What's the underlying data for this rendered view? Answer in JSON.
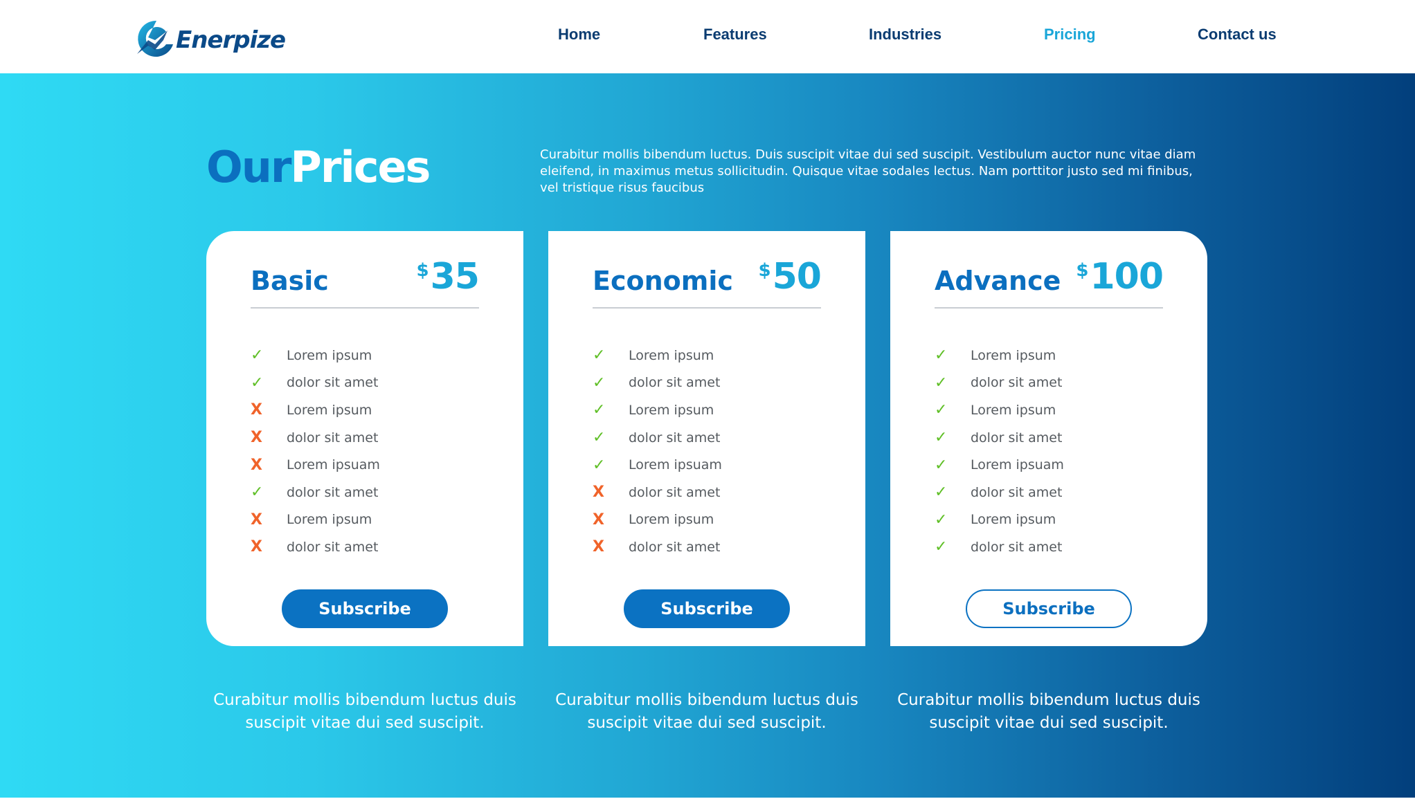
{
  "brand": {
    "name": "Enerpize",
    "colors": {
      "primary": "#0b6fbf",
      "accent": "#1aa6d8",
      "navy": "#0b3c71",
      "check": "#5fbf26",
      "cross": "#f0632a"
    }
  },
  "nav": {
    "items": [
      {
        "label": "Home",
        "active": false
      },
      {
        "label": "Features",
        "active": false
      },
      {
        "label": "Industries",
        "active": false
      },
      {
        "label": "Pricing",
        "active": true
      },
      {
        "label": "Contact us",
        "active": false
      }
    ]
  },
  "hero": {
    "title_part1": "Our",
    "title_part2": "Prices",
    "intro": "Curabitur mollis bibendum luctus. Duis suscipit vitae dui sed suscipit. Vestibulum auctor nunc vitae diam eleifend, in maximus metus sollicitudin. Quisque vitae sodales lectus. Nam porttitor justo sed mi finibus, vel tristique risus faucibus"
  },
  "plans": [
    {
      "name": "Basic",
      "currency": "$",
      "price": "35",
      "button": "Subscribe",
      "button_style": "solid",
      "caption": "Curabitur mollis bibendum luctus duis suscipit vitae dui sed suscipit.",
      "features": [
        {
          "label": "Lorem ipsum",
          "included": true
        },
        {
          "label": "dolor sit amet",
          "included": true
        },
        {
          "label": "Lorem ipsum",
          "included": false
        },
        {
          "label": "dolor sit amet",
          "included": false
        },
        {
          "label": "Lorem ipsuam",
          "included": false
        },
        {
          "label": "dolor sit amet",
          "included": true
        },
        {
          "label": "Lorem ipsum",
          "included": false
        },
        {
          "label": "dolor sit amet",
          "included": false
        }
      ]
    },
    {
      "name": "Economic",
      "currency": "$",
      "price": "50",
      "button": "Subscribe",
      "button_style": "solid",
      "caption": "Curabitur mollis bibendum luctus duis suscipit vitae dui sed suscipit.",
      "features": [
        {
          "label": "Lorem ipsum",
          "included": true
        },
        {
          "label": "dolor sit amet",
          "included": true
        },
        {
          "label": "Lorem ipsum",
          "included": true
        },
        {
          "label": "dolor sit amet",
          "included": true
        },
        {
          "label": "Lorem ipsuam",
          "included": true
        },
        {
          "label": "dolor sit amet",
          "included": false
        },
        {
          "label": "Lorem ipsum",
          "included": false
        },
        {
          "label": "dolor sit amet",
          "included": false
        }
      ]
    },
    {
      "name": "Advance",
      "currency": "$",
      "price": "100",
      "button": "Subscribe",
      "button_style": "outline",
      "caption": "Curabitur mollis bibendum luctus duis suscipit vitae dui sed suscipit.",
      "features": [
        {
          "label": "Lorem ipsum",
          "included": true
        },
        {
          "label": "dolor sit amet",
          "included": true
        },
        {
          "label": "Lorem ipsum",
          "included": true
        },
        {
          "label": "dolor sit amet",
          "included": true
        },
        {
          "label": "Lorem ipsuam",
          "included": true
        },
        {
          "label": "dolor sit amet",
          "included": true
        },
        {
          "label": "Lorem ipsum",
          "included": true
        },
        {
          "label": "dolor sit amet",
          "included": true
        }
      ]
    }
  ],
  "icons": {
    "included": "check-icon",
    "excluded": "cross-icon",
    "included_glyph": "✓",
    "excluded_glyph": "X"
  }
}
